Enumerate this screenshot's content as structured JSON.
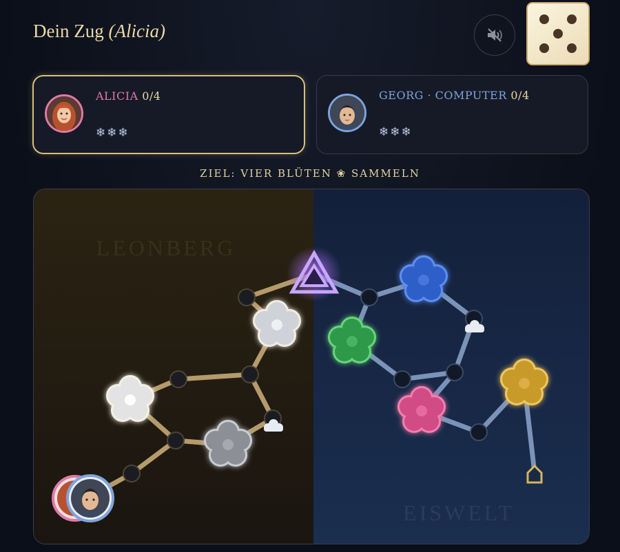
{
  "header": {
    "title_prefix": "Dein Zug",
    "current_player": "(Alicia)"
  },
  "dice": {
    "value": 5
  },
  "sound_button": {
    "icon": "speaker-muted-icon"
  },
  "players": [
    {
      "name": "ALICIA",
      "score": "0/4",
      "snowflakes": "❄❄❄",
      "color": "#e07aa6",
      "active": true
    },
    {
      "name": "GEORG · COMPUTER",
      "score": "0/4",
      "snowflakes": "❄❄❄",
      "color": "#7fa4dc",
      "active": false
    }
  ],
  "goal_text": "ZIEL: VIER BLÜTEN ❀ SAMMELN",
  "board": {
    "left_world": "LEONBERG",
    "right_world": "EISWELT"
  }
}
